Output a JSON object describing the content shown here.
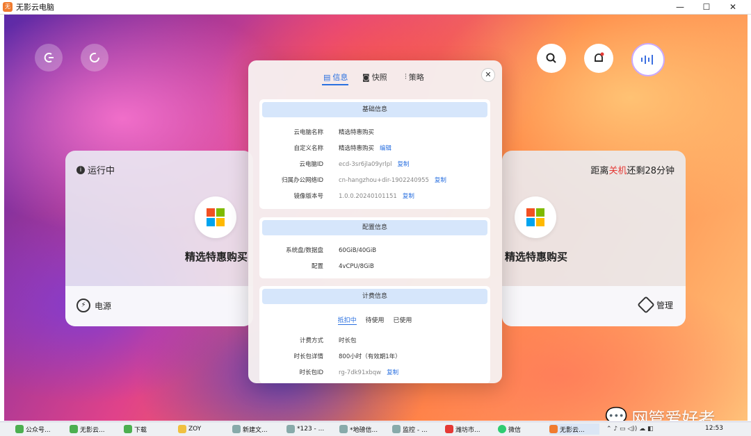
{
  "window": {
    "title": "无影云电脑",
    "logo": "无影"
  },
  "top_controls": {
    "search_icon": "search-icon",
    "bell_icon": "bell-icon",
    "voice_icon": "voice-wave-icon"
  },
  "cards": {
    "left": {
      "status": "运行中",
      "name": "精选特惠购买",
      "footer": "电源"
    },
    "right": {
      "countdown_prefix": "距离",
      "countdown_highlight": "关机",
      "countdown_suffix": "还剩28分钟",
      "name": "精选特惠购买",
      "footer": "管理"
    }
  },
  "modal": {
    "tabs": [
      "信息",
      "快照",
      "策略"
    ],
    "active_tab": "信息",
    "basic": {
      "title": "基础信息",
      "rows": [
        {
          "label": "云电脑名称",
          "value": "精选特惠购买"
        },
        {
          "label": "自定义名称",
          "value": "精选特惠购买",
          "link": "编辑"
        },
        {
          "label": "云电脑ID",
          "value": "ecd-3sr6jla09yrlpl",
          "link": "复制"
        },
        {
          "label": "归属办公网络ID",
          "value": "cn-hangzhou+dir-1902240955",
          "link": "复制"
        },
        {
          "label": "镜像版本号",
          "value": "1.0.0.20240101151",
          "link": "复制"
        }
      ]
    },
    "config": {
      "title": "配置信息",
      "rows": [
        {
          "label": "系统盘/数据盘",
          "value": "60GiB/40GiB"
        },
        {
          "label": "配置",
          "value": "4vCPU/8GiB"
        }
      ]
    },
    "billing": {
      "title": "计费信息",
      "subtabs": [
        "抵扣中",
        "待使用",
        "已使用"
      ],
      "active_subtab": "抵扣中",
      "rows": [
        {
          "label": "计费方式",
          "value": "时长包"
        },
        {
          "label": "时长包详情",
          "value": "800小时（有效期1年）"
        },
        {
          "label": "时长包ID",
          "value": "rg-7dk91xbqw",
          "link": "复制"
        }
      ]
    }
  },
  "taskbar": {
    "items": [
      "公众号...",
      "无影云...",
      "下载",
      "ZOY",
      "新建文...",
      "*123 - ...",
      "*地磅信...",
      "监控 - ...",
      "潍坊市...",
      "微信",
      "无影云..."
    ],
    "time": "12:53"
  },
  "watermark": "网管爱好者"
}
